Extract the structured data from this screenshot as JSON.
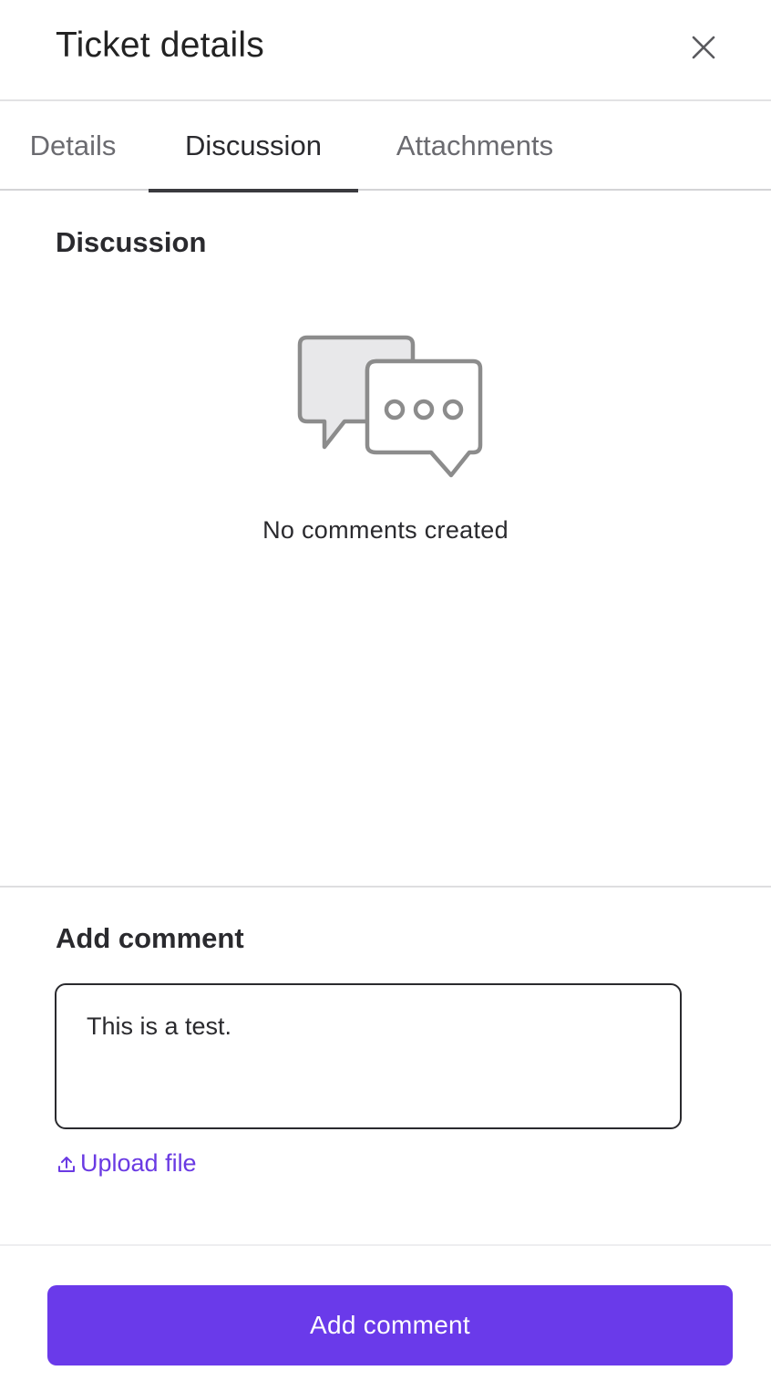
{
  "header": {
    "title": "Ticket details",
    "close_icon": "close-icon"
  },
  "tabs": [
    {
      "label": "Details",
      "active": false
    },
    {
      "label": "Discussion",
      "active": true
    },
    {
      "label": "Attachments",
      "active": false
    }
  ],
  "discussion": {
    "heading": "Discussion",
    "empty_icon": "chat-bubbles-icon",
    "empty_message": "No comments created"
  },
  "add_comment": {
    "heading": "Add comment",
    "input_value": "This is a test.",
    "upload_label": "Upload file",
    "upload_icon": "upload-icon"
  },
  "footer": {
    "submit_label": "Add comment"
  },
  "colors": {
    "accent": "#6a3aea",
    "link": "#6a3ae3",
    "text": "#2a2a2e",
    "muted_tab": "#6b6b70",
    "icon_gray": "#8c8c8c",
    "bubble_fill": "#e8e8ea"
  }
}
